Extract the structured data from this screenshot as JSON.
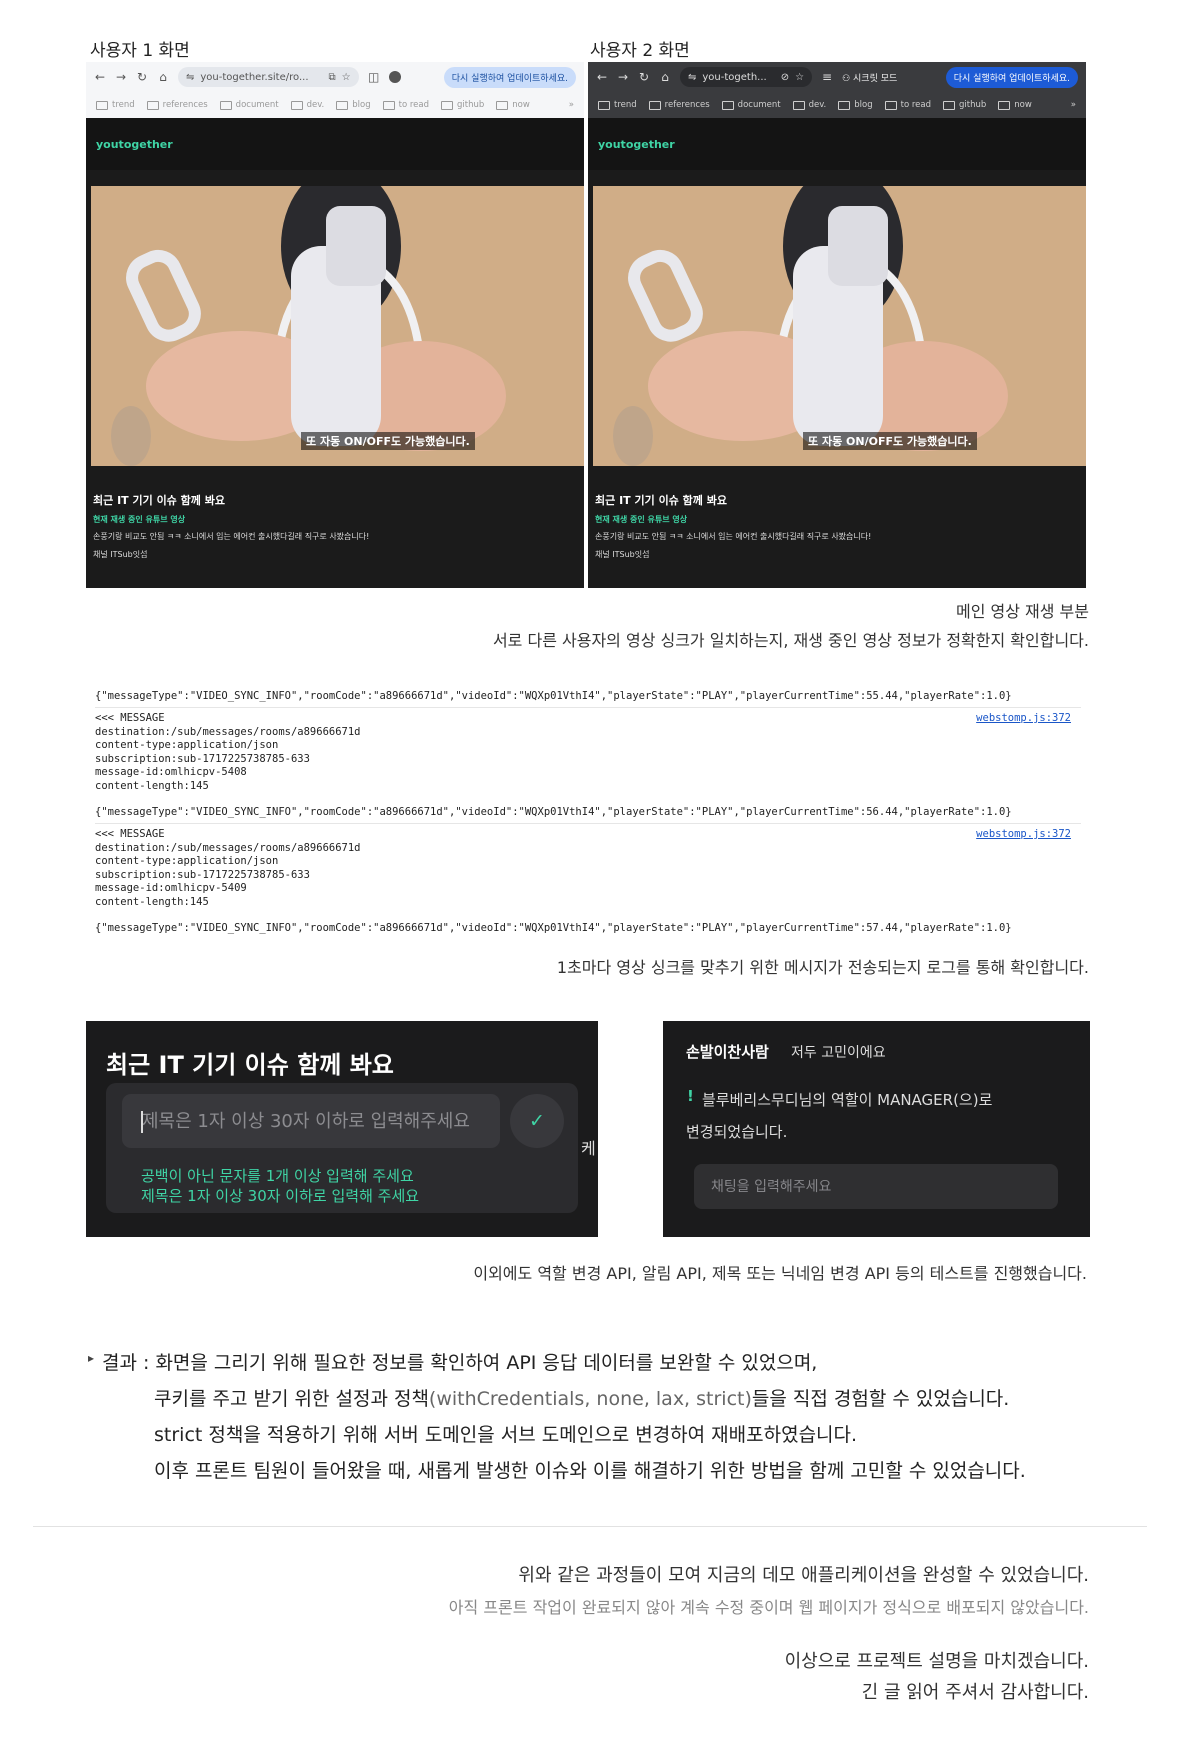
{
  "user_labels": [
    "사용자 1 화면",
    "사용자 2 화면"
  ],
  "browser": {
    "url_user1": "you-together.site/ro...",
    "url_user2": "you-togeth...",
    "update_label": "다시 실행하여 업데이트하세요.",
    "incognito_label": "시크릿 모드",
    "bookmarks": [
      "trend",
      "references",
      "document",
      "dev.",
      "blog",
      "to read",
      "github",
      "now"
    ],
    "bookmarks_more": "»"
  },
  "app": {
    "brand": "youtogether",
    "subtitle": "또 자동 ON/OFF도 가능했습니다.",
    "video_title": "최근 IT 기기 이슈 함께 봐요",
    "now_playing_label": "현재 재생 중인 유튜브 영상",
    "video_desc": "손풍기랑 비교도 안됨 ㅋㅋ 소니에서 입는 에어컨 출시했다길래 직구로 사봤습니다!",
    "channel": "채널 ITSub잇섭"
  },
  "captions": {
    "main_title": "메인 영상 재생 부분",
    "main_desc": "서로 다른 사용자의 영상 싱크가 일치하는지, 재생 중인 영상 정보가 정확한지 확인합니다.",
    "log_desc": "1초마다 영상 싱크를 맞추기 위한 메시지가 전송되는지 로그를 통해 확인합니다.",
    "api_desc": "이외에도 역할 변경 API, 알림 API, 제목 또는 닉네임 변경 API 등의 테스트를 진행했습니다."
  },
  "log": {
    "json_lines": [
      "{\"messageType\":\"VIDEO_SYNC_INFO\",\"roomCode\":\"a89666671d\",\"videoId\":\"WQXp01VthI4\",\"playerState\":\"PLAY\",\"playerCurrentTime\":55.44,\"playerRate\":1.0}",
      "{\"messageType\":\"VIDEO_SYNC_INFO\",\"roomCode\":\"a89666671d\",\"videoId\":\"WQXp01VthI4\",\"playerState\":\"PLAY\",\"playerCurrentTime\":56.44,\"playerRate\":1.0}",
      "{\"messageType\":\"VIDEO_SYNC_INFO\",\"roomCode\":\"a89666671d\",\"videoId\":\"WQXp01VthI4\",\"playerState\":\"PLAY\",\"playerCurrentTime\":57.44,\"playerRate\":1.0}"
    ],
    "messages": [
      {
        "source": "webstomp.js:372",
        "lines": [
          "<<< MESSAGE",
          "destination:/sub/messages/rooms/a89666671d",
          "content-type:application/json",
          "subscription:sub-1717225738785-633",
          "message-id:omlhicpv-5408",
          "content-length:145"
        ]
      },
      {
        "source": "webstomp.js:372",
        "lines": [
          "<<< MESSAGE",
          "destination:/sub/messages/rooms/a89666671d",
          "content-type:application/json",
          "subscription:sub-1717225738785-633",
          "message-id:omlhicpv-5409",
          "content-length:145"
        ]
      }
    ]
  },
  "title_edit": {
    "heading": "최근 IT 기기 이슈 함께 봐요",
    "placeholder": "제목은 1자 이상 30자 이하로 입력해주세요",
    "confirm_icon": "✓",
    "errors": [
      "공백이 아닌 문자를 1개 이상 입력해 주세요",
      "제목은 1자 이상 30자 이하로 입력해 주세요"
    ],
    "side_glyph": "케"
  },
  "chat": {
    "username": "손발이찬사람",
    "message": "저두 고민이에요",
    "notice_mark": "!",
    "notice": "블루베리스무디님의 역할이 MANAGER(으)로 변경되었습니다.",
    "input_placeholder": "채팅을 입력해주세요"
  },
  "result": {
    "bullet": "▸",
    "lines": [
      "결과 : 화면을 그리기 위해 필요한 정보를 확인하여 API 응답 데이터를 보완할 수 있었으며,",
      "쿠키를 주고 받기 위한 설정과 정책",
      "(withCredentials, none, lax, strict)",
      "들을 직접 경험할 수 있었습니다.",
      "strict 정책을 적용하기 위해 서버 도메인을 서브 도메인으로 변경하여 재배포하였습니다.",
      "이후 프론트 팀원이 들어왔을 때, 새롭게 발생한 이슈와 이를 해결하기 위한 방법을 함께 고민할 수 있었습니다."
    ]
  },
  "outro": {
    "line1": "위와 같은 과정들이 모여 지금의 데모 애플리케이션을 완성할 수 있었습니다.",
    "line2": "아직 프론트 작업이 완료되지 않아 계속 수정 중이며 웹 페이지가 정식으로 배포되지 않았습니다.",
    "line3": "이상으로 프로젝트 설명을 마치겠습니다.",
    "line4": "긴 글 읽어 주셔서 감사합니다."
  },
  "colors": {
    "accent": "#3fd4a5",
    "dark_bg": "#1b1b1b",
    "link": "#1a56c8"
  }
}
